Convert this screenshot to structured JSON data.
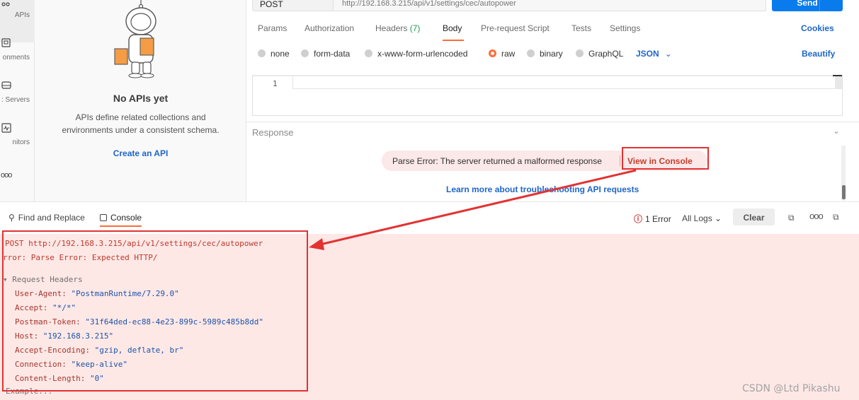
{
  "sidebar": {
    "items": [
      {
        "label": "APIs",
        "icon": "apis-icon",
        "active": true
      },
      {
        "label": "onments",
        "icon": "environments-icon"
      },
      {
        "label": ": Servers",
        "icon": "mock-servers-icon"
      },
      {
        "label": "nitors",
        "icon": "monitors-icon"
      },
      {
        "label": "",
        "icon": "more-icon"
      }
    ]
  },
  "apis_panel": {
    "title": "No APIs yet",
    "description": "APIs define related collections and environments under a consistent schema.",
    "create_link": "Create an API"
  },
  "request": {
    "method": "POST",
    "url": "http://192.168.3.215/api/v1/settings/cec/autopower",
    "send_label": "Send",
    "tabs": [
      {
        "label": "Params"
      },
      {
        "label": "Authorization"
      },
      {
        "label": "Headers",
        "count": "(7)"
      },
      {
        "label": "Body",
        "active": true
      },
      {
        "label": "Pre-request Script"
      },
      {
        "label": "Tests"
      },
      {
        "label": "Settings"
      }
    ],
    "cookies_label": "Cookies",
    "body_modes": [
      {
        "label": "none"
      },
      {
        "label": "form-data"
      },
      {
        "label": "x-www-form-urlencoded"
      },
      {
        "label": "raw",
        "selected": true
      },
      {
        "label": "binary"
      },
      {
        "label": "GraphQL"
      }
    ],
    "format": "JSON",
    "beautify_label": "Beautify",
    "editor_line": "1"
  },
  "response": {
    "label": "Response",
    "error_text": "Parse Error: The server returned a malformed response",
    "view_console_label": "View in Console",
    "learn_more": "Learn more about troubleshooting API requests"
  },
  "console": {
    "find_replace": "Find and Replace",
    "tab_label": "Console",
    "error_count": "1 Error",
    "log_filter": "All Logs",
    "clear_label": "Clear",
    "lines": {
      "request": "POST http://192.168.3.215/api/v1/settings/cec/autopower",
      "error": "rror: Parse Error: Expected HTTP/",
      "section": "Request Headers",
      "footer": "Example..."
    },
    "headers": [
      {
        "key": "User-Agent:",
        "value": "\"PostmanRuntime/7.29.0\""
      },
      {
        "key": "Accept:",
        "value": "\"*/*\""
      },
      {
        "key": "Postman-Token:",
        "value": "\"31f64ded-ec88-4e23-899c-5989c485b8dd\""
      },
      {
        "key": "Host:",
        "value": "\"192.168.3.215\""
      },
      {
        "key": "Accept-Encoding:",
        "value": "\"gzip, deflate, br\""
      },
      {
        "key": "Connection:",
        "value": "\"keep-alive\""
      },
      {
        "key": "Content-Length:",
        "value": "\"0\""
      }
    ]
  },
  "watermark": "CSDN @Ltd Pikashu",
  "colors": {
    "accent_orange": "#ff6c37",
    "link_blue": "#1f66c8",
    "send_blue": "#097bed",
    "annotation_red": "#e33232",
    "error_bg": "#fde8e6"
  }
}
